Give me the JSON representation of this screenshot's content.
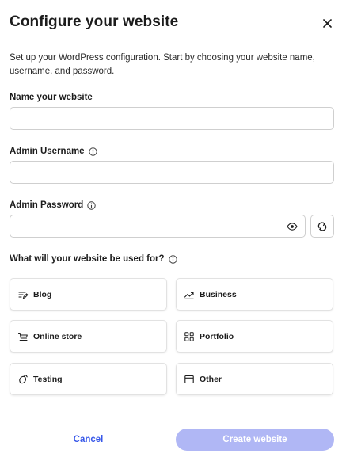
{
  "dialog": {
    "title": "Configure your website",
    "description": "Set up your WordPress configuration. Start by choosing your website name, username, and password."
  },
  "fields": {
    "site_name": {
      "label": "Name your website",
      "value": "",
      "placeholder": ""
    },
    "admin_username": {
      "label": "Admin Username",
      "value": "",
      "placeholder": ""
    },
    "admin_password": {
      "label": "Admin Password",
      "value": "",
      "placeholder": ""
    }
  },
  "usage": {
    "question": "What will your website be used for?",
    "options": [
      {
        "label": "Blog",
        "icon": "blog-icon"
      },
      {
        "label": "Business",
        "icon": "trend-icon"
      },
      {
        "label": "Online store",
        "icon": "cart-icon"
      },
      {
        "label": "Portfolio",
        "icon": "grid-icon"
      },
      {
        "label": "Testing",
        "icon": "flask-icon"
      },
      {
        "label": "Other",
        "icon": "window-icon"
      }
    ]
  },
  "actions": {
    "cancel_label": "Cancel",
    "create_label": "Create website"
  },
  "colors": {
    "accent": "#3858e9",
    "primary_disabled": "#b0b7f5"
  }
}
